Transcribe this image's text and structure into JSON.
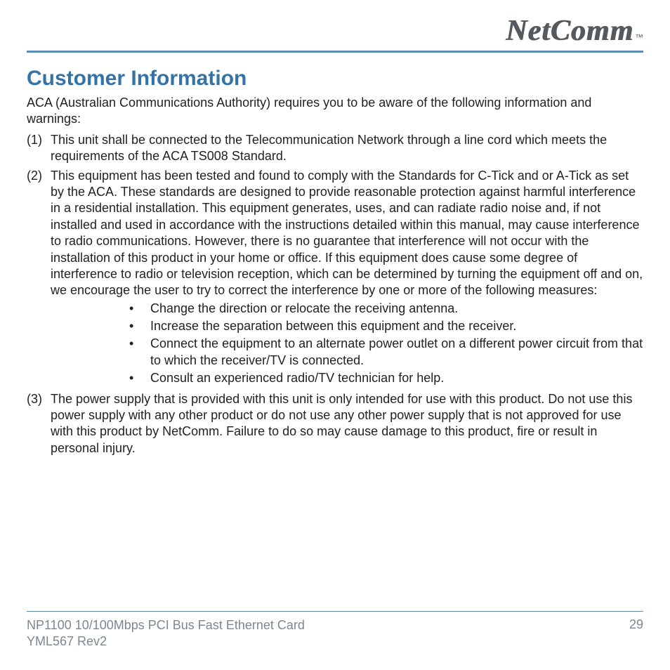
{
  "brand": {
    "name": "NetComm",
    "tm": "™"
  },
  "heading": "Customer Information",
  "intro": "ACA (Australian Communications Authority) requires you to be aware of the following information and warnings:",
  "items": [
    {
      "num": "(1)",
      "text": "This unit shall be connected to the Telecommunication Network through a line cord which meets the requirements of the ACA TS008 Standard."
    },
    {
      "num": "(2)",
      "text": "This equipment has been tested and found to comply with the Standards for C-Tick and or A-Tick as set by the ACA. These standards are designed to provide reasonable protection against harmful interference in a residential installation. This equipment generates, uses, and can radiate radio noise and, if not installed and used in accordance with the instructions detailed within this manual, may cause interference to radio communications. However, there is no guarantee that interference will not occur with the installation of this product in your home or office. If this equipment does cause some degree of interference to radio or television reception, which can be determined by turning the equipment off and on, we encourage the user to try to correct the interference by one or more of the following measures:",
      "sub": [
        "Change the direction or relocate the receiving antenna.",
        "Increase the separation between this equipment and the receiver.",
        "Connect the equipment to an alternate power outlet on a different power circuit from that to which the receiver/TV is connected.",
        "Consult an experienced radio/TV technician for help."
      ]
    },
    {
      "num": "(3)",
      "text": "The power supply that is provided with this unit is only intended for use with this product. Do not use this power supply with any other product or do not use any other power supply that is not approved for use with this product by NetComm. Failure to do so may cause damage to this product, fire or result in personal injury."
    }
  ],
  "footer": {
    "product": "NP1100 10/100Mbps PCI Bus Fast Ethernet Card",
    "rev": "YML567 Rev2",
    "page": "29"
  }
}
